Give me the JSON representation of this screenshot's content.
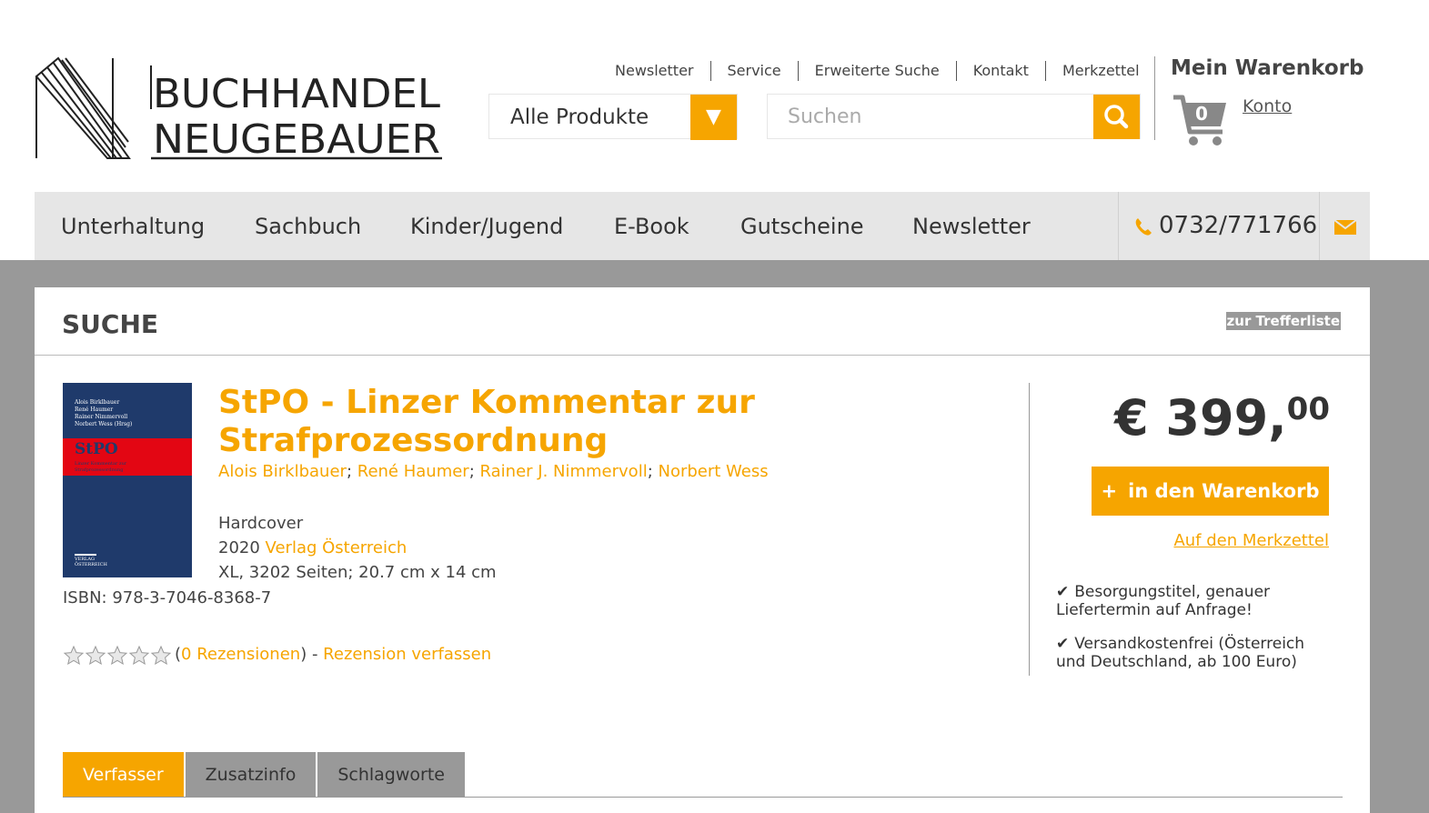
{
  "brand": {
    "line1": "BUCHHANDEL",
    "line2": "NEUGEBAUER",
    "accent_color": "#f6a500"
  },
  "top_links": [
    "Newsletter",
    "Service",
    "Erweiterte Suche",
    "Kontakt",
    "Merkzettel"
  ],
  "product_filter": {
    "selected": "Alle Produkte",
    "icon": "triangle-down-icon"
  },
  "search": {
    "placeholder": "Suchen",
    "value": "",
    "icon": "search-icon"
  },
  "cart": {
    "title": "Mein Warenkorb",
    "count": "0",
    "account_link": "Konto",
    "icon": "cart-icon"
  },
  "nav": {
    "items": [
      "Unterhaltung",
      "Sachbuch",
      "Kinder/Jugend",
      "E-Book",
      "Gutscheine",
      "Newsletter"
    ],
    "phone": "0732/771766",
    "phone_icon": "phone-icon",
    "mail_icon": "envelope-icon"
  },
  "section": {
    "title": "SUCHE",
    "back_link": "zur Trefferliste"
  },
  "book": {
    "title": "StPO - Linzer Kommentar zur Strafprozessordnung",
    "authors": [
      "Alois Birklbauer",
      "René Haumer",
      "Rainer J. Nimmervoll",
      "Norbert Wess"
    ],
    "binding": "Hardcover",
    "year": "2020",
    "publisher": "Verlag Österreich",
    "details": "XL, 3202 Seiten; 20.7 cm x 14 cm",
    "isbn": "ISBN: 978-3-7046-8368-7",
    "cover": {
      "editors": [
        "Alois Birklbauer",
        "René Haumer",
        "Rainer Nimmervoll",
        "Norbert Wess (Hrsg)"
      ],
      "title": "StPO",
      "subtitle": "Linzer Kommentar zur Strafprozessordnung",
      "publisher": [
        "VERLAG",
        "ÖSTERREICH"
      ]
    },
    "rating": {
      "stars": 0,
      "max": 5,
      "reviews": "0 Rezensionen",
      "write": "Rezension verfassen"
    }
  },
  "purchase": {
    "price_main": "€ 399,",
    "price_cents": "00",
    "add_to_cart": "in den Warenkorb",
    "add_icon": "plus-icon",
    "wishlist": "Auf den Merkzettel",
    "features": [
      "Besorgungstitel, genauer Liefertermin auf Anfrage!",
      "Versandkostenfrei (Österreich und Deutschland, ab 100 Euro)"
    ]
  },
  "tabs": [
    {
      "label": "Verfasser",
      "active": true
    },
    {
      "label": "Zusatzinfo",
      "active": false
    },
    {
      "label": "Schlagworte",
      "active": false
    }
  ]
}
